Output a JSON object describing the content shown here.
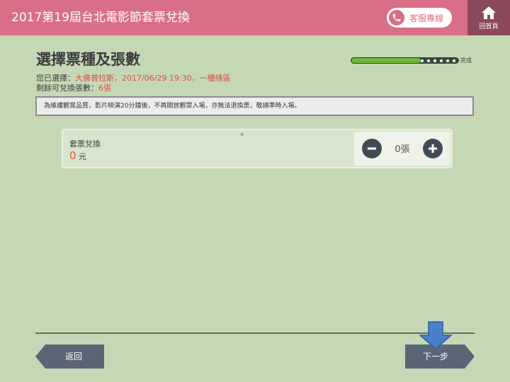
{
  "header": {
    "title": "2017第19屆台北電影節套票兌換",
    "service_label": "客服專線",
    "home_label": "回首頁"
  },
  "page": {
    "title": "選擇票種及張數",
    "selection_prefix": "您已選擇：",
    "selection_value": "大佛普拉斯，2017/06/29 19:30，一樓綠區",
    "remaining_prefix": "剩餘可兌換張數：",
    "remaining_value": "6張"
  },
  "progress": {
    "label": "完成",
    "fraction": 0.65
  },
  "notice": "為維護觀賞品質，影片映演20分鐘後，不再開放觀眾入場，亦無法退換票，敬請準時入場。",
  "ticket": {
    "name": "套票兌換",
    "price": "0",
    "price_unit": "元",
    "quantity": "0張"
  },
  "nav": {
    "back_label": "返回",
    "next_label": "下一步"
  },
  "colors": {
    "header": "#d96f86",
    "home": "#8a4a5c",
    "background": "#c5d8b6",
    "accent_red": "#e04a4a",
    "button": "#5a6676",
    "progress_fill": "#6fb63b",
    "arrow_hint": "#4a7fc9"
  },
  "icons": {
    "service": "phone-icon",
    "home": "home-icon",
    "decrease": "minus-icon",
    "increase": "plus-icon",
    "hint": "down-arrow-icon"
  }
}
